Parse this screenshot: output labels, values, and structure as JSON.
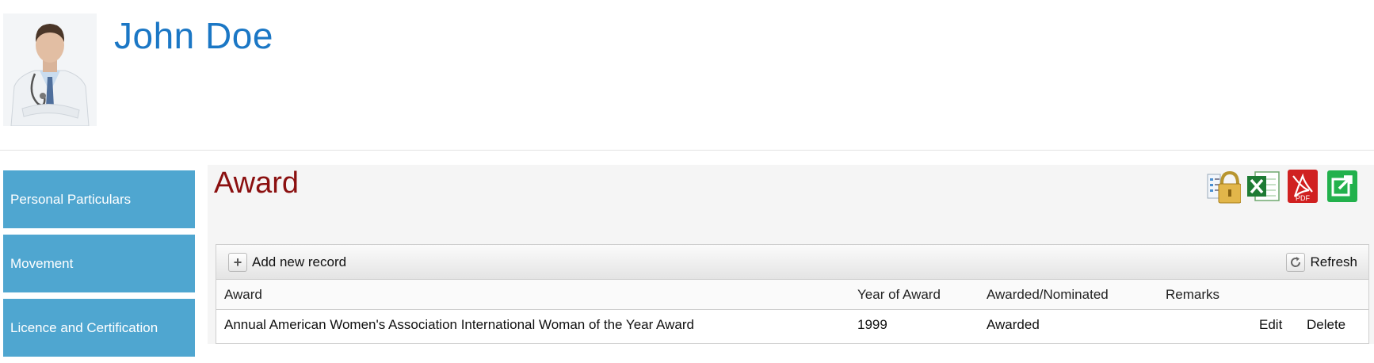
{
  "profile": {
    "name": "John Doe"
  },
  "sidebar": {
    "items": [
      {
        "label": "Personal Particulars"
      },
      {
        "label": "Movement"
      },
      {
        "label": "Licence and Certification"
      }
    ]
  },
  "main": {
    "title": "Award",
    "toolbar_icons": [
      "lock-permissions-icon",
      "excel-export-icon",
      "pdf-export-icon",
      "external-open-icon"
    ],
    "grid": {
      "add_label": "Add new record",
      "refresh_label": "Refresh",
      "columns": [
        "Award",
        "Year of Award",
        "Awarded/Nominated",
        "Remarks"
      ],
      "rows": [
        {
          "award": "Annual American Women's Association International Woman of the Year Award",
          "year": "1999",
          "status": "Awarded",
          "remarks": "",
          "edit": "Edit",
          "delete": "Delete"
        }
      ]
    }
  },
  "colors": {
    "accent": "#1b77c5",
    "sidebar": "#4fa6d0",
    "title": "#8b1010"
  }
}
